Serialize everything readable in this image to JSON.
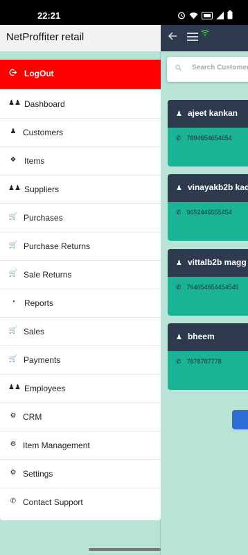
{
  "status_bar": {
    "time": "22:21",
    "icons": [
      "alarm-icon",
      "wifi-icon",
      "volte-icon",
      "signal-icon",
      "battery-icon"
    ]
  },
  "drawer": {
    "title": "NetProffiter retail",
    "logout_label": "LogOut",
    "items": [
      {
        "label": "Dashboard",
        "icon": "users-icon"
      },
      {
        "label": "Customers",
        "icon": "user-icon"
      },
      {
        "label": "Items",
        "icon": "tag-icon"
      },
      {
        "label": "Suppliers",
        "icon": "users-icon"
      },
      {
        "label": "Purchases",
        "icon": "cart-icon"
      },
      {
        "label": "Purchase Returns",
        "icon": "cart-icon"
      },
      {
        "label": "Sale Returns",
        "icon": "cart-icon"
      },
      {
        "label": "Reports",
        "icon": "pie-chart-icon"
      },
      {
        "label": "Sales",
        "icon": "cart-icon"
      },
      {
        "label": "Payments",
        "icon": "cart-icon"
      },
      {
        "label": "Employees",
        "icon": "users-icon"
      },
      {
        "label": "CRM",
        "icon": "gear-icon"
      },
      {
        "label": "Item Management",
        "icon": "gear-icon"
      },
      {
        "label": "Settings",
        "icon": "gear-icon"
      },
      {
        "label": "Contact Support",
        "icon": "phone-icon"
      }
    ]
  },
  "background": {
    "search_placeholder": "Search Customer",
    "customers": [
      {
        "name": "ajeet kankan",
        "phone": "7894654654654"
      },
      {
        "name": "vinayakb2b kad",
        "phone": "9652446555454"
      },
      {
        "name": "vittalb2b magg",
        "phone": "764654654454545"
      },
      {
        "name": "bheem",
        "phone": "7878787778"
      }
    ]
  },
  "colors": {
    "accent_red": "#ff0000",
    "toolbar_navy": "#2e3a4e",
    "card_teal": "#1ab394",
    "drawer_bg": "#b8e3d6"
  }
}
